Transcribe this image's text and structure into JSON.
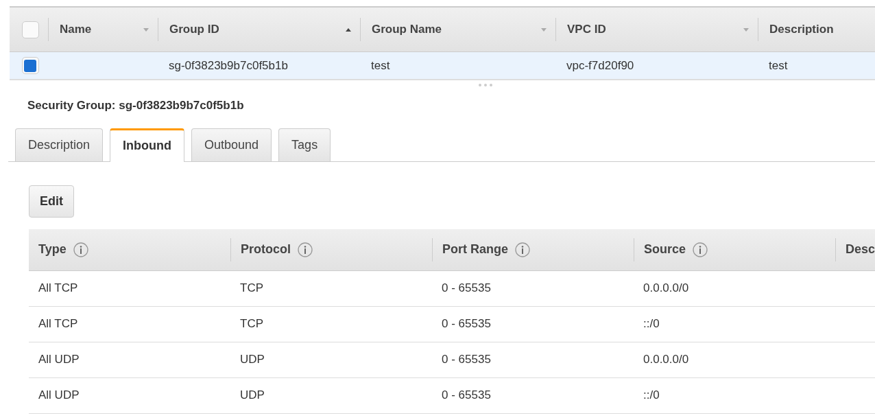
{
  "groups_table": {
    "select_all": {
      "checked": false
    },
    "columns": [
      {
        "label": "Name",
        "sorted": false
      },
      {
        "label": "Group ID",
        "sorted": true
      },
      {
        "label": "Group Name",
        "sorted": false
      },
      {
        "label": "VPC ID",
        "sorted": false
      },
      {
        "label": "Description"
      }
    ],
    "rows": [
      {
        "selected": true,
        "cells": [
          "",
          "sg-0f3823b9b7c0f5b1b",
          "test",
          "vpc-f7d20f90",
          "test"
        ]
      }
    ]
  },
  "detail": {
    "title": "Security Group: sg-0f3823b9b7c0f5b1b",
    "tabs": [
      {
        "label": "Description",
        "selected": false
      },
      {
        "label": "Inbound",
        "selected": true
      },
      {
        "label": "Outbound",
        "selected": false
      },
      {
        "label": "Tags",
        "selected": false
      }
    ],
    "edit_button": "Edit",
    "rules_table": {
      "columns": [
        "Type",
        "Protocol",
        "Port Range",
        "Source",
        "Desc"
      ],
      "rows": [
        [
          "All TCP",
          "TCP",
          "0 - 65535",
          "0.0.0.0/0"
        ],
        [
          "All TCP",
          "TCP",
          "0 - 65535",
          "::/0"
        ],
        [
          "All UDP",
          "UDP",
          "0 - 65535",
          "0.0.0.0/0"
        ],
        [
          "All UDP",
          "UDP",
          "0 - 65535",
          "::/0"
        ]
      ]
    }
  }
}
